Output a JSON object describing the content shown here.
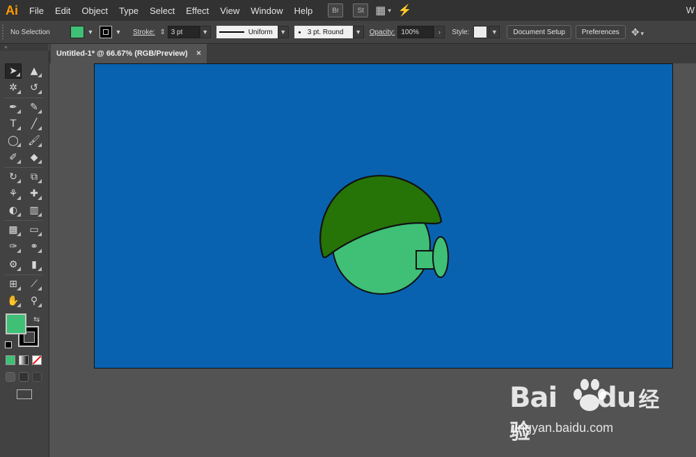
{
  "app": {
    "logo": "Ai"
  },
  "menu": {
    "items": [
      "File",
      "Edit",
      "Object",
      "Type",
      "Select",
      "Effect",
      "View",
      "Window",
      "Help"
    ],
    "icons": [
      "Br",
      "St"
    ],
    "workspace_right": "W"
  },
  "control": {
    "selection": "No Selection",
    "fill_color": "#3fc076",
    "stroke_label": "Stroke:",
    "stroke_weight": "3 pt",
    "variable_width": "Uniform",
    "brush": "3 pt. Round",
    "opacity_label": "Opacity:",
    "opacity_value": "100%",
    "style_label": "Style:",
    "document_setup": "Document Setup",
    "preferences": "Preferences"
  },
  "document": {
    "tab_title": "Untitled-1* @ 66.67% (RGB/Preview)",
    "close": "×"
  },
  "artwork": {
    "background": "#0862b0",
    "head_color": "#3fc076",
    "hat_color": "#267308"
  },
  "tools_panel": {
    "fill": "#3fc076",
    "stroke": "#000000"
  },
  "watermark": {
    "brand": "Bai",
    "brand_suffix": "du",
    "chinese": "经验",
    "url": "jingyan.baidu.com"
  }
}
